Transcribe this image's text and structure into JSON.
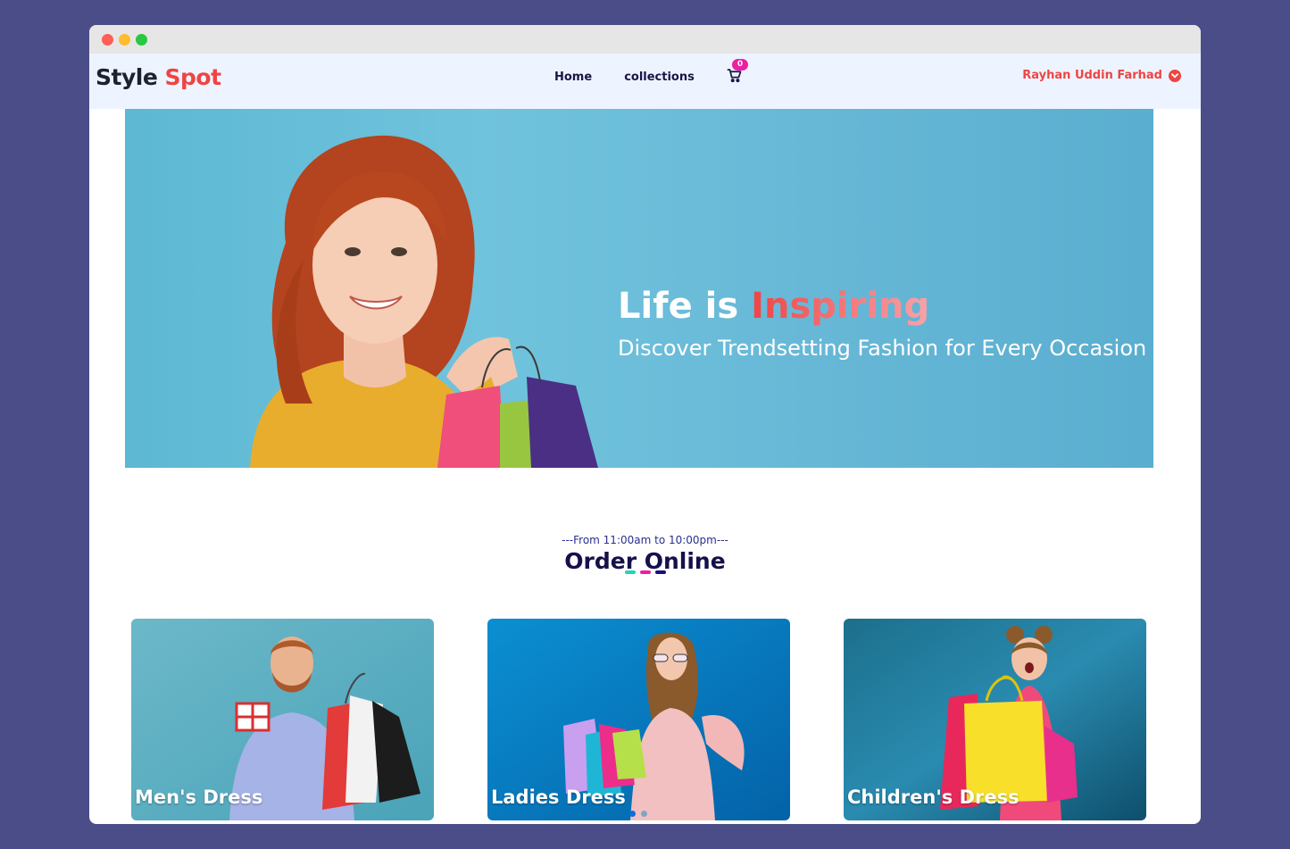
{
  "brand": {
    "name": "Style",
    "accent": "Spot"
  },
  "nav": {
    "links": [
      "Home",
      "collections"
    ],
    "cart_count": "0"
  },
  "user": {
    "name": "Rayhan Uddin Farhad"
  },
  "hero": {
    "title_plain": "Life is ",
    "title_accent": "Inspiring",
    "subtitle": "Discover Trendsetting Fashion for Every Occasion"
  },
  "section": {
    "hours": "---From 11:00am to 10:00pm---",
    "title": "Order Online"
  },
  "cards": [
    {
      "label": "Men's Dress"
    },
    {
      "label": "Ladies Dress"
    },
    {
      "label": "Children's Dress"
    }
  ],
  "colors": {
    "page_bg": "#4a4d87",
    "navbar_bg": "#eef4ff",
    "accent_red": "#ef4444",
    "navy": "#16104a",
    "cart_badge": "#ec1fa5",
    "underline": [
      "#1ed6b8",
      "#ec1fa5",
      "#16107e"
    ]
  },
  "icons": [
    "cart-icon",
    "chevron-down-icon"
  ]
}
